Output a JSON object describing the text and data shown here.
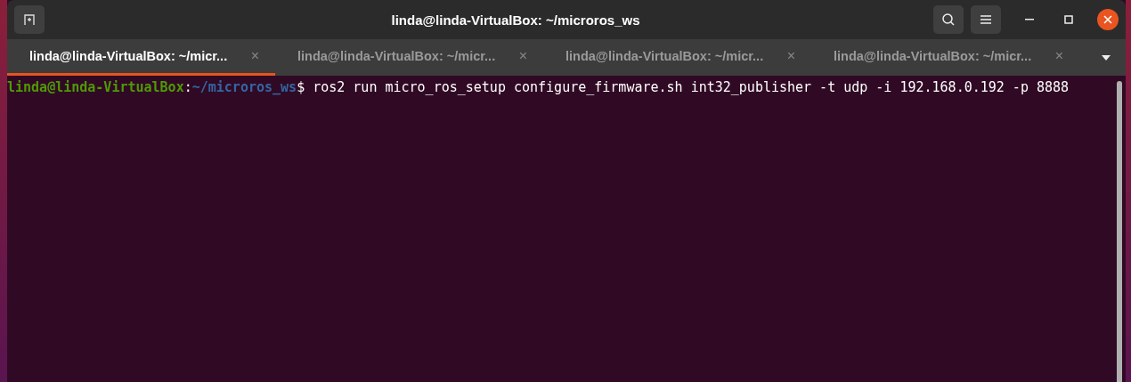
{
  "window": {
    "title": "linda@linda-VirtualBox: ~/microros_ws"
  },
  "tabs": [
    {
      "label": "linda@linda-VirtualBox: ~/micr...",
      "selected": true,
      "close": "×"
    },
    {
      "label": "linda@linda-VirtualBox: ~/micr...",
      "selected": false,
      "close": "×"
    },
    {
      "label": "linda@linda-VirtualBox: ~/micr...",
      "selected": false,
      "close": "×"
    },
    {
      "label": "linda@linda-VirtualBox: ~/micr...",
      "selected": false,
      "close": "×"
    }
  ],
  "terminal": {
    "lines": [
      {
        "user_host": "linda@linda-VirtualBox",
        "separator": ":",
        "path": "~/microros_ws",
        "command": "$ ros2 run micro_ros_setup configure_firmware.sh int32_publisher -t udp -i 192.168.0.192 -p 8888"
      }
    ]
  }
}
